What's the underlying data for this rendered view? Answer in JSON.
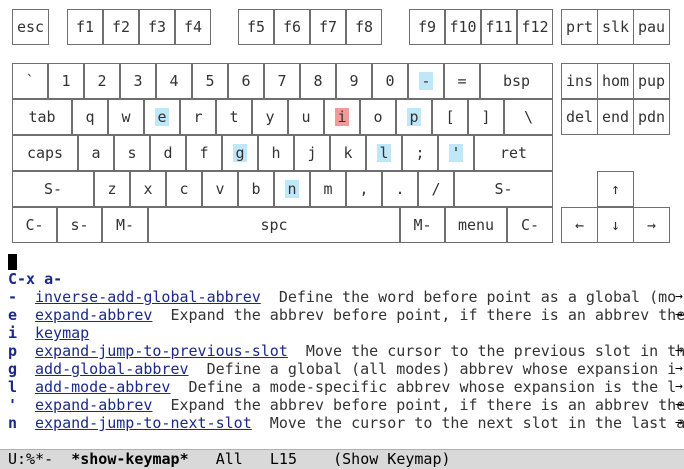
{
  "keyboard": {
    "rows": [
      [
        {
          "label": "esc"
        },
        {
          "label": "f1"
        },
        {
          "label": "f2"
        },
        {
          "label": "f3"
        },
        {
          "label": "f4"
        },
        {
          "label": "f5"
        },
        {
          "label": "f6"
        },
        {
          "label": "f7"
        },
        {
          "label": "f8"
        },
        {
          "label": "f9"
        },
        {
          "label": "f10"
        },
        {
          "label": "f11"
        },
        {
          "label": "f12"
        },
        {
          "label": "prt"
        },
        {
          "label": "slk"
        },
        {
          "label": "pau"
        }
      ],
      [
        {
          "label": "`"
        },
        {
          "label": "1"
        },
        {
          "label": "2"
        },
        {
          "label": "3"
        },
        {
          "label": "4"
        },
        {
          "label": "5"
        },
        {
          "label": "6"
        },
        {
          "label": "7"
        },
        {
          "label": "8"
        },
        {
          "label": "9"
        },
        {
          "label": "0"
        },
        {
          "label": "-",
          "highlight": "blue"
        },
        {
          "label": "="
        },
        {
          "label": "bsp"
        },
        {
          "label": "ins"
        },
        {
          "label": "hom"
        },
        {
          "label": "pup"
        }
      ],
      [
        {
          "label": "tab"
        },
        {
          "label": "q"
        },
        {
          "label": "w"
        },
        {
          "label": "e",
          "highlight": "blue"
        },
        {
          "label": "r"
        },
        {
          "label": "t"
        },
        {
          "label": "y"
        },
        {
          "label": "u"
        },
        {
          "label": "i",
          "highlight": "red"
        },
        {
          "label": "o"
        },
        {
          "label": "p",
          "highlight": "blue"
        },
        {
          "label": "["
        },
        {
          "label": "]"
        },
        {
          "label": "\\"
        },
        {
          "label": "del"
        },
        {
          "label": "end"
        },
        {
          "label": "pdn"
        }
      ],
      [
        {
          "label": "caps"
        },
        {
          "label": "a"
        },
        {
          "label": "s"
        },
        {
          "label": "d"
        },
        {
          "label": "f"
        },
        {
          "label": "g",
          "highlight": "blue"
        },
        {
          "label": "h"
        },
        {
          "label": "j"
        },
        {
          "label": "k"
        },
        {
          "label": "l",
          "highlight": "blue"
        },
        {
          "label": ";"
        },
        {
          "label": "'",
          "highlight": "blue"
        },
        {
          "label": "ret"
        }
      ],
      [
        {
          "label": "S-"
        },
        {
          "label": "z"
        },
        {
          "label": "x"
        },
        {
          "label": "c"
        },
        {
          "label": "v"
        },
        {
          "label": "b"
        },
        {
          "label": "n",
          "highlight": "blue"
        },
        {
          "label": "m"
        },
        {
          "label": ","
        },
        {
          "label": "."
        },
        {
          "label": "/"
        },
        {
          "label": "S-"
        },
        {
          "label": "↑"
        }
      ],
      [
        {
          "label": "C-"
        },
        {
          "label": "s-"
        },
        {
          "label": "M-"
        },
        {
          "label": "spc"
        },
        {
          "label": "M-"
        },
        {
          "label": "menu"
        },
        {
          "label": "C-"
        },
        {
          "label": "←"
        },
        {
          "label": "↓"
        },
        {
          "label": "→"
        }
      ]
    ]
  },
  "colors": {
    "highlight_blue": "#bfe7f7",
    "highlight_red": "#f29a9a",
    "link": "#1b2a8a",
    "modeline_bg": "#d9d9d9"
  },
  "prefix": "C-x a-",
  "bindings": [
    {
      "key": "-",
      "command": "inverse-add-global-abbrev",
      "description": "Define the word before point as a global (mo"
    },
    {
      "key": "e",
      "command": "expand-abbrev",
      "description": "Expand the abbrev before point, if there is an abbrev the"
    },
    {
      "key": "i",
      "command": "keymap",
      "description": ""
    },
    {
      "key": "p",
      "command": "expand-jump-to-previous-slot",
      "description": "Move the cursor to the previous slot in th"
    },
    {
      "key": "g",
      "command": "add-global-abbrev",
      "description": "Define a global (all modes) abbrev whose expansion i"
    },
    {
      "key": "l",
      "command": "add-mode-abbrev",
      "description": "Define a mode-specific abbrev whose expansion is the l"
    },
    {
      "key": "'",
      "command": "expand-abbrev",
      "description": "Expand the abbrev before point, if there is an abbrev the"
    },
    {
      "key": "n",
      "command": "expand-jump-to-next-slot",
      "description": "Move the cursor to the next slot in the last a"
    }
  ],
  "truncation_marker": "→",
  "modeline": {
    "status": "U:%*-",
    "buffer": "*show-keymap*",
    "position": "All",
    "line": "L15",
    "mode": "(Show Keymap)"
  }
}
